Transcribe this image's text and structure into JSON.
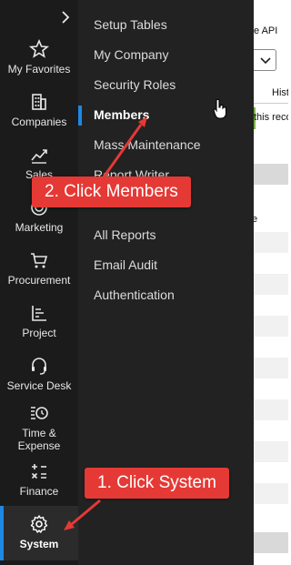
{
  "nav": {
    "items": [
      {
        "label": "My Favorites",
        "icon": "star-icon"
      },
      {
        "label": "Companies",
        "icon": "building-icon"
      },
      {
        "label": "Sales",
        "icon": "chart-line-icon"
      },
      {
        "label": "Marketing",
        "icon": "target-icon"
      },
      {
        "label": "Procurement",
        "icon": "cart-icon"
      },
      {
        "label": "Project",
        "icon": "project-icon"
      },
      {
        "label": "Service Desk",
        "icon": "headset-icon"
      },
      {
        "label": "Time &",
        "label2": "Expense",
        "icon": "clock-list-icon"
      },
      {
        "label": "Finance",
        "icon": "calculator-icon"
      },
      {
        "label": "System",
        "icon": "gear-icon",
        "active": true
      }
    ]
  },
  "flyout": {
    "items": [
      {
        "label": "Setup Tables"
      },
      {
        "label": "My Company"
      },
      {
        "label": "Security Roles"
      },
      {
        "label": "Members",
        "active": true
      },
      {
        "label": "Mass Maintenance"
      },
      {
        "label": "Report Writer"
      },
      {
        "label": "All Reports"
      },
      {
        "label": "Email Audit"
      },
      {
        "label": "Authentication"
      }
    ]
  },
  "background_page": {
    "api_label": "e API",
    "tab_label": "Hist",
    "message": "this reco",
    "cell_text": "e"
  },
  "callouts": {
    "step1": "1. Click System",
    "step2": "2. Click Members"
  },
  "colors": {
    "nav_bg": "#1b1b1b",
    "flyout_bg": "#222222",
    "accent": "#1e88e5",
    "callout": "#e53935",
    "success_border": "#7cb342"
  }
}
